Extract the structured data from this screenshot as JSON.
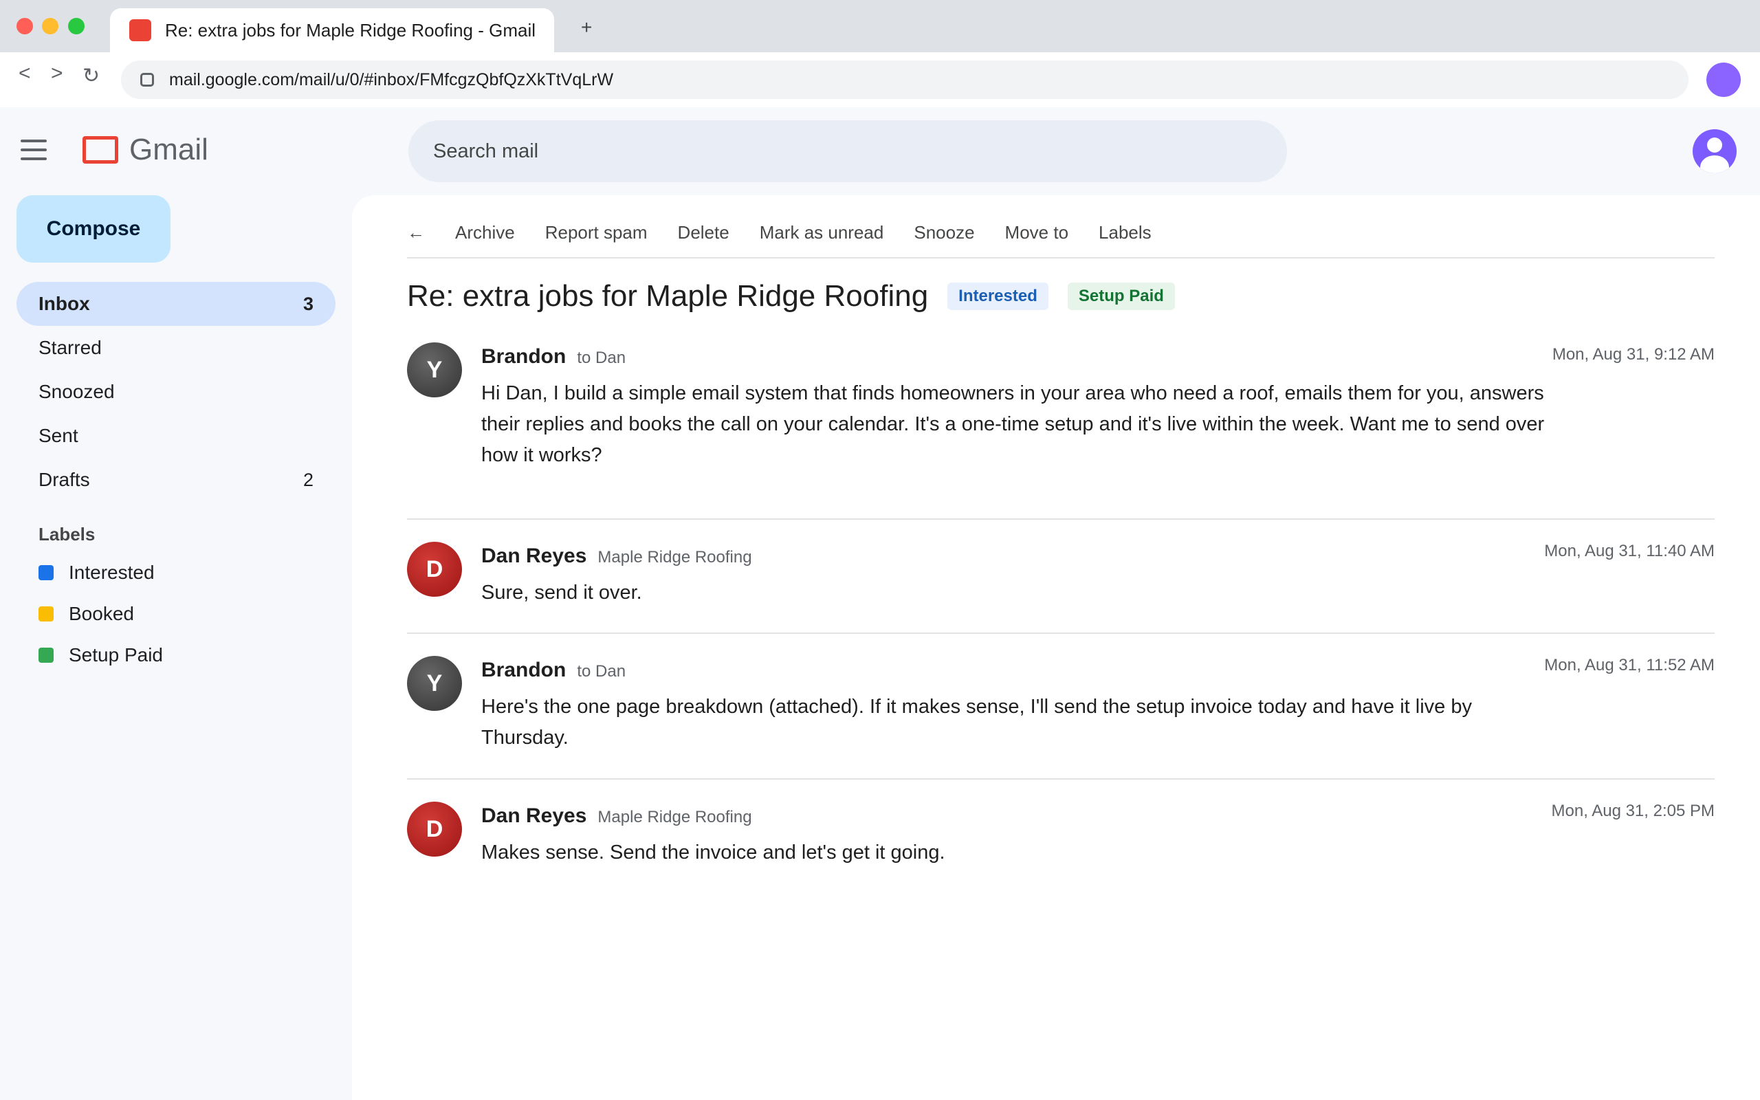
{
  "browser": {
    "tab_title": "Re: extra jobs for Maple Ridge Roofing - Gmail",
    "new_tab": "+",
    "back": "<",
    "forward": ">",
    "reload": "↻",
    "url": "mail.google.com/mail/u/0/#inbox/FMfcgzQbfQzXkTtVqLrW"
  },
  "header": {
    "app_name": "Gmail",
    "search_placeholder": "Search mail"
  },
  "sidebar": {
    "compose": "Compose",
    "items": [
      {
        "label": "Inbox",
        "count": "3"
      },
      {
        "label": "Starred",
        "count": ""
      },
      {
        "label": "Snoozed",
        "count": ""
      },
      {
        "label": "Sent",
        "count": ""
      },
      {
        "label": "Drafts",
        "count": "2"
      }
    ],
    "labels_heading": "Labels",
    "labels": [
      {
        "label": "Interested",
        "color": "#1a73e8"
      },
      {
        "label": "Booked",
        "color": "#fbbc04"
      },
      {
        "label": "Setup Paid",
        "color": "#34a853"
      }
    ]
  },
  "toolbar": {
    "back": "←",
    "archive": "Archive",
    "report_spam": "Report spam",
    "delete": "Delete",
    "mark_unread": "Mark as unread",
    "snooze": "Snooze",
    "move_to": "Move to",
    "labels": "Labels"
  },
  "thread": {
    "subject": "Re: extra jobs for Maple Ridge Roofing",
    "tags": [
      "Interested",
      "Setup Paid"
    ],
    "messages": [
      {
        "initial": "Y",
        "sender": "Brandon",
        "meta": "to Dan",
        "time": "Mon, Aug 31, 9:12 AM",
        "body": "Hi Dan, I build a simple email system that finds homeowners in your area who need a roof, emails them for you, answers their replies and books the call on your calendar. It's a one-time setup and it's live within the week. Want me to send over how it works?"
      },
      {
        "initial": "D",
        "sender": "Dan Reyes",
        "meta": "Maple Ridge Roofing",
        "time": "Mon, Aug 31, 11:40 AM",
        "body": "Sure, send it over."
      },
      {
        "initial": "Y",
        "sender": "Brandon",
        "meta": "to Dan",
        "time": "Mon, Aug 31, 11:52 AM",
        "body": "Here's the one page breakdown (attached). If it makes sense, I'll send the setup invoice today and have it live by Thursday."
      },
      {
        "initial": "D",
        "sender": "Dan Reyes",
        "meta": "Maple Ridge Roofing",
        "time": "Mon, Aug 31, 2:05 PM",
        "body": "Makes sense. Send the invoice and let's get it going."
      }
    ]
  }
}
